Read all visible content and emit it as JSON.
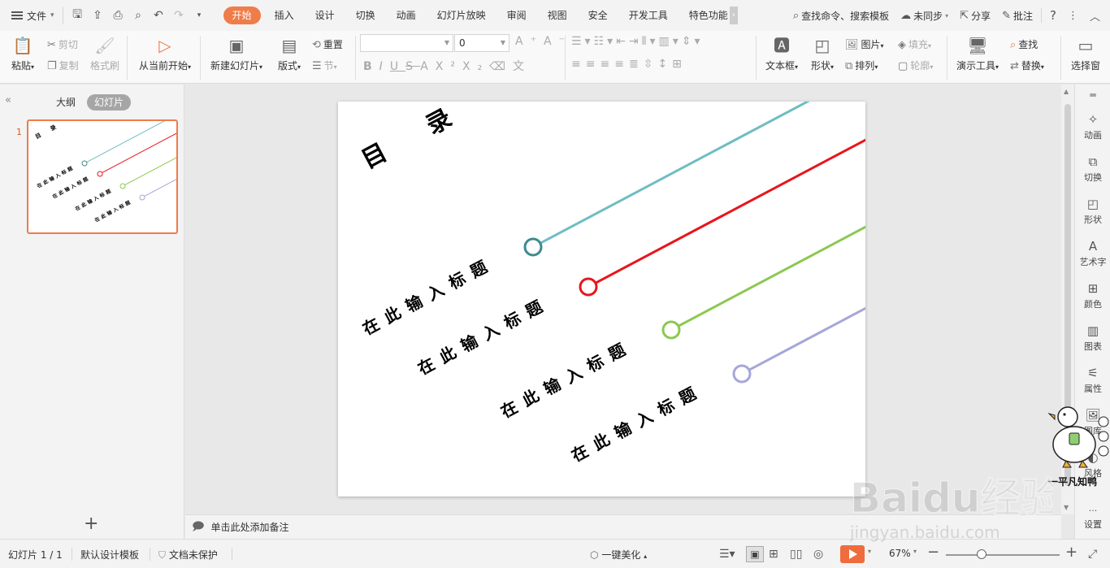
{
  "menubar": {
    "file_label": "文件",
    "tabs": [
      "开始",
      "插入",
      "设计",
      "切换",
      "动画",
      "幻灯片放映",
      "审阅",
      "视图",
      "安全",
      "开发工具",
      "特色功能"
    ],
    "active_tab": "开始",
    "search_label": "查找命令、搜索模板",
    "sync_label": "未同步",
    "share_label": "分享",
    "comment_label": "批注"
  },
  "ribbon": {
    "paste": "粘贴",
    "cut": "剪切",
    "copy": "复制",
    "format_painter": "格式刷",
    "from_current": "从当前开始",
    "new_slide": "新建幻灯片",
    "layout": "版式",
    "reset": "重置",
    "section": "节",
    "font_size_value": "0",
    "textbox": "文本框",
    "shape": "形状",
    "picture": "图片",
    "fill": "填充",
    "arrange": "排列",
    "outline": "轮廓",
    "present_tools": "演示工具",
    "find": "查找",
    "replace": "替换",
    "select_pane": "选择窗"
  },
  "leftpanel": {
    "outline_tab": "大纲",
    "slides_tab": "幻灯片",
    "slide_number": "1"
  },
  "slide": {
    "title": "目　　录",
    "items": [
      "在此输入标题",
      "在此输入标题",
      "在此输入标题",
      "在此输入标题"
    ],
    "colors": [
      "#6fbdc2",
      "#e8151c",
      "#8cc850",
      "#a6a6d8"
    ],
    "circle_colors": [
      "#3d8a8d",
      "#e8151c",
      "#8cc850",
      "#a6a6d8"
    ]
  },
  "notes": {
    "placeholder": "单击此处添加备注"
  },
  "rightpanel": {
    "items": [
      "动画",
      "切换",
      "形状",
      "艺术字",
      "颜色",
      "图表",
      "属性",
      "图库",
      "风格",
      "设置"
    ]
  },
  "statusbar": {
    "slide_info": "幻灯片 1 / 1",
    "template": "默认设计模板",
    "protection": "文档未保护",
    "beautify": "一键美化",
    "zoom": "67%"
  },
  "watermark": {
    "duck_text": "一平凡知鸭",
    "baidu_brand": "Baidu经验",
    "baidu_url": "jingyan.baidu.com"
  }
}
